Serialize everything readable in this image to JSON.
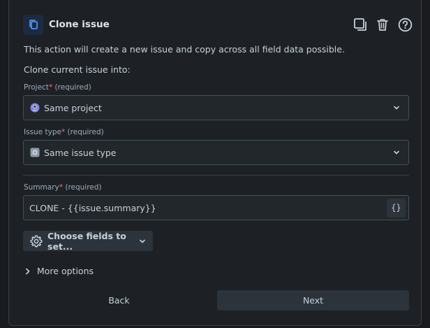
{
  "header": {
    "title": "Clone issue",
    "accent_color": "#579dff"
  },
  "description": "This action will create a new issue and copy across all field data possible.",
  "clone_into_label": "Clone current issue into:",
  "project": {
    "label": "Project",
    "required_marker": "*",
    "required_text": "(required)",
    "value": "Same project"
  },
  "issue_type": {
    "label": "Issue type",
    "required_marker": "*",
    "required_text": "(required)",
    "value": "Same issue type"
  },
  "summary": {
    "label": "Summary",
    "required_marker": "*",
    "required_text": "(required)",
    "value": "CLONE - {{issue.summary}}",
    "smart_value_button": "{}"
  },
  "choose_fields_label": "Choose fields to set...",
  "more_options_label": "More options",
  "footer": {
    "back_label": "Back",
    "next_label": "Next"
  }
}
